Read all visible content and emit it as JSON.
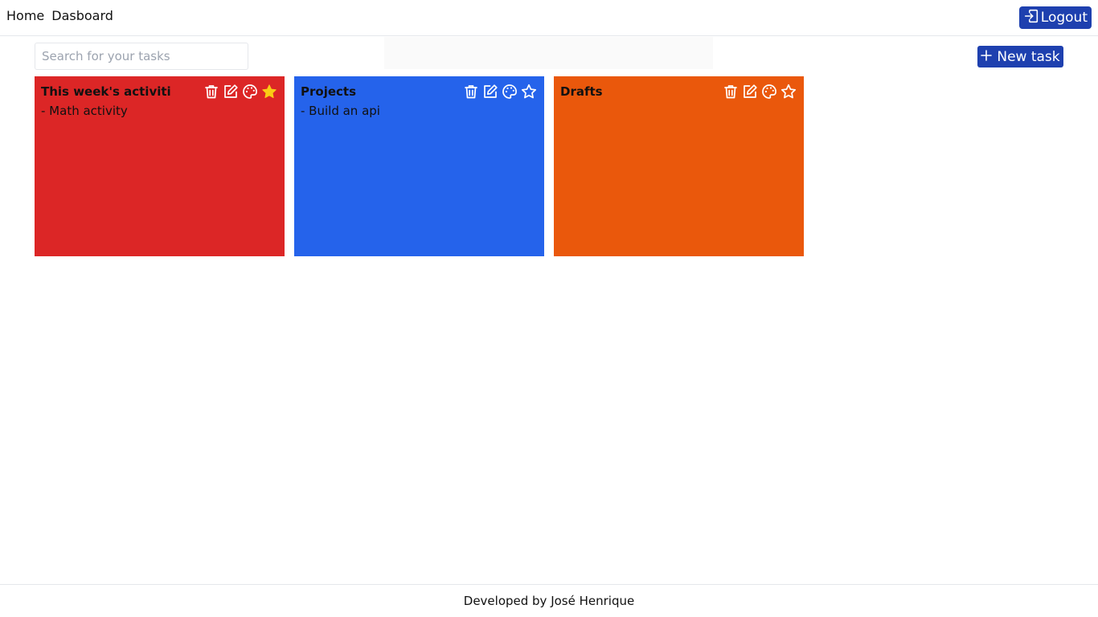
{
  "nav": {
    "links": [
      "Home",
      "Dasboard"
    ],
    "logout_label": "Logout",
    "logout_icon": "sign-in-icon",
    "button_color": "#1e40af"
  },
  "search": {
    "placeholder": "Search for your tasks",
    "value": ""
  },
  "toolbar": {
    "new_task_label": "New task",
    "new_task_icon": "plus-icon"
  },
  "cards": [
    {
      "title": "This week's activiti",
      "color": "#dc2626",
      "starred": true,
      "items": [
        "- Math activity"
      ]
    },
    {
      "title": "Projects",
      "color": "#2563eb",
      "starred": false,
      "items": [
        "- Build an api"
      ]
    },
    {
      "title": "Drafts",
      "color": "#ea580c",
      "starred": false,
      "items": []
    }
  ],
  "card_actions": [
    "trash-icon",
    "edit-icon",
    "palette-icon",
    "star-icon"
  ],
  "star_active_color": "#facc15",
  "footer": {
    "text": "Developed by José Henrique"
  }
}
